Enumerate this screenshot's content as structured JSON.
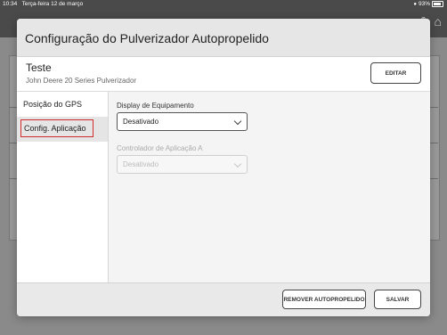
{
  "status_bar": {
    "time": "10:34",
    "date": "Terça-feira 12 de março",
    "battery": "93%"
  },
  "modal": {
    "title": "Configuração do Pulverizador Autopropelido",
    "machine_name": "Teste",
    "machine_model": "John Deere 20 Series Pulverizador",
    "edit_label": "EDITAR"
  },
  "sidebar": {
    "items": [
      {
        "label": "Posição do GPS"
      },
      {
        "label": "Config. Aplicação",
        "selected": true
      }
    ]
  },
  "content": {
    "display_label": "Display de Equipamento",
    "display_value": "Desativado",
    "controller_label": "Controlador de Aplicação A",
    "controller_value": "Desativado"
  },
  "footer": {
    "remove_label": "REMOVER AUTOPROPELIDO",
    "save_label": "SALVAR"
  },
  "colors": {
    "highlight": "#d32b2b",
    "header_bg": "#e6e6e6",
    "selected_bg": "#e5e5e5"
  }
}
